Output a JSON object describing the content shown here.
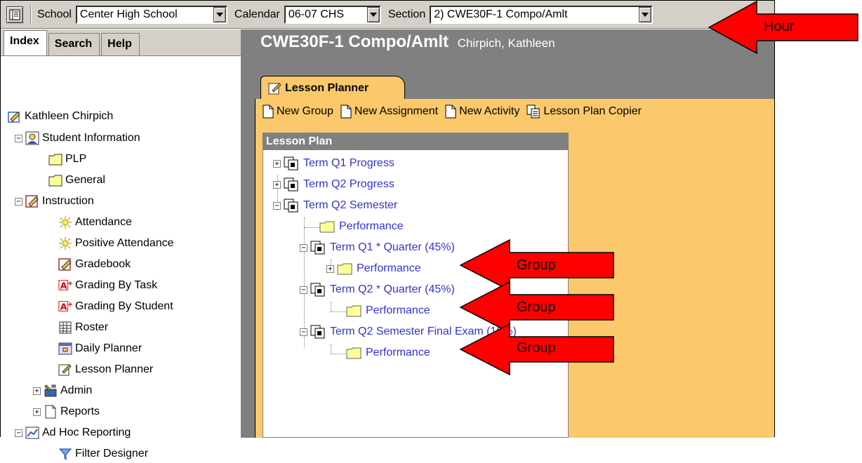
{
  "toolbar": {
    "school_label": "School",
    "school_value": "Center High School",
    "calendar_label": "Calendar",
    "calendar_value": "06-07 CHS",
    "section_label": "Section",
    "section_value": "2) CWE30F-1 Compo/Amlt"
  },
  "sidebar": {
    "tabs": [
      "Index",
      "Search",
      "Help"
    ],
    "active_tab": "Index",
    "tree": {
      "root": "Kathleen Chirpich",
      "student_information": "Student Information",
      "plp": "PLP",
      "general": "General",
      "instruction": "Instruction",
      "attendance": "Attendance",
      "positive_attendance": "Positive Attendance",
      "gradebook": "Gradebook",
      "grading_by_task": "Grading By Task",
      "grading_by_student": "Grading By Student",
      "roster": "Roster",
      "daily_planner": "Daily Planner",
      "lesson_planner": "Lesson Planner",
      "admin": "Admin",
      "reports": "Reports",
      "ad_hoc_reporting": "Ad Hoc Reporting",
      "filter_designer": "Filter Designer"
    }
  },
  "main": {
    "title": "CWE30F-1 Compo/Amlt",
    "teacher": "Chirpich, Kathleen",
    "tab_label": "Lesson Planner",
    "actions": {
      "new_group": "New Group",
      "new_assignment": "New Assignment",
      "new_activity": "New Activity",
      "copier": "Lesson Plan Copier"
    },
    "lesson_plan": {
      "header": "Lesson Plan",
      "term_q1_progress": "Term Q1 Progress",
      "term_q2_progress": "Term Q2 Progress",
      "term_q2_semester": "Term Q2 Semester",
      "performance_1": "Performance",
      "term_q1_quarter": "Term Q1 * Quarter (45%)",
      "performance_2": "Performance",
      "term_q2_quarter": "Term Q2 * Quarter (45%)",
      "performance_3": "Performance",
      "final_exam": "Term Q2 Semester Final Exam (10%)",
      "performance_4": "Performance"
    }
  },
  "annotations": {
    "hour": "Hour",
    "group_1": "Group",
    "group_2": "Group",
    "group_3": "Group",
    "arrow_color": "#ff0000"
  }
}
